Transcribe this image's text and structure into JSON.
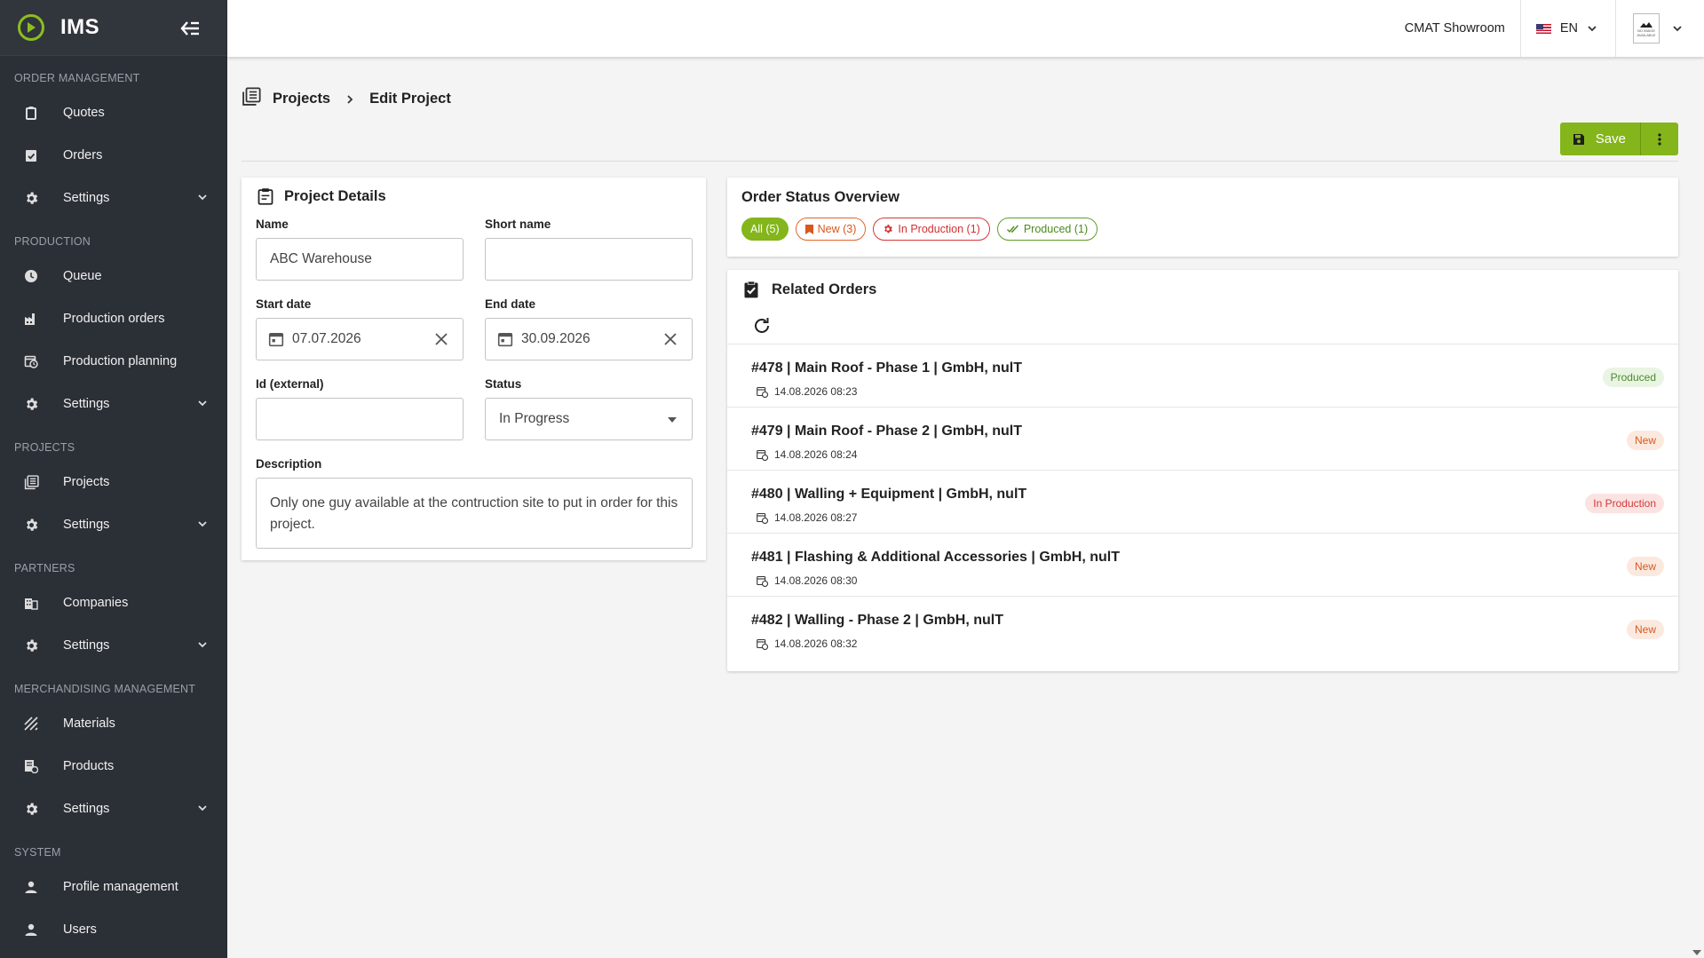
{
  "app": {
    "name": "IMS",
    "accent": "#84b51a"
  },
  "sidebar": {
    "sections": [
      {
        "title": "ORDER MANAGEMENT",
        "items": [
          {
            "label": "Quotes",
            "icon": "clipboard-icon"
          },
          {
            "label": "Orders",
            "icon": "clipboard-check-icon"
          },
          {
            "label": "Settings",
            "icon": "gear-icon",
            "expandable": true
          }
        ]
      },
      {
        "title": "PRODUCTION",
        "items": [
          {
            "label": "Queue",
            "icon": "clock-icon"
          },
          {
            "label": "Production orders",
            "icon": "factory-icon"
          },
          {
            "label": "Production planning",
            "icon": "calendar-clock-icon"
          },
          {
            "label": "Settings",
            "icon": "gear-icon",
            "expandable": true
          }
        ]
      },
      {
        "title": "PROJECTS",
        "items": [
          {
            "label": "Projects",
            "icon": "list-box-icon"
          },
          {
            "label": "Settings",
            "icon": "gear-icon",
            "expandable": true
          }
        ]
      },
      {
        "title": "PARTNERS",
        "items": [
          {
            "label": "Companies",
            "icon": "building-icon"
          },
          {
            "label": "Settings",
            "icon": "gear-icon",
            "expandable": true
          }
        ]
      },
      {
        "title": "MERCHANDISING MANAGEMENT",
        "items": [
          {
            "label": "Materials",
            "icon": "texture-icon"
          },
          {
            "label": "Products",
            "icon": "product-list-icon"
          },
          {
            "label": "Settings",
            "icon": "gear-icon",
            "expandable": true
          }
        ]
      },
      {
        "title": "SYSTEM",
        "items": [
          {
            "label": "Profile management",
            "icon": "person-icon"
          },
          {
            "label": "Users",
            "icon": "person-icon"
          }
        ]
      }
    ]
  },
  "topbar": {
    "org": "CMAT Showroom",
    "language": "EN",
    "avatar_text": [
      "NO IMAGE",
      "AVAILABLE"
    ]
  },
  "breadcrumb": {
    "parent": "Projects",
    "current": "Edit Project"
  },
  "actions": {
    "save_label": "Save"
  },
  "details": {
    "title": "Project Details",
    "name_label": "Name",
    "name_value": "ABC Warehouse",
    "short_label": "Short name",
    "short_value": "",
    "start_label": "Start date",
    "start_value": "07.07.2026",
    "end_label": "End date",
    "end_value": "30.09.2026",
    "external_label": "Id (external)",
    "external_value": "",
    "status_label": "Status",
    "status_value": "In Progress",
    "description_label": "Description",
    "description_value": "Only one guy available at the contruction site to put in order for this project."
  },
  "overview": {
    "title": "Order Status Overview",
    "chips": {
      "all": "All (5)",
      "new": "New (3)",
      "in_production": "In Production (1)",
      "produced": "Produced (1)"
    },
    "colors": {
      "new": "#d9561e",
      "in_production": "#d13033",
      "produced": "#4c8a1d"
    }
  },
  "related": {
    "title": "Related Orders",
    "orders": [
      {
        "title": "#478 | Main Roof - Phase 1 | GmbH, nulT",
        "date": "14.08.2026 08:23",
        "status": "Produced",
        "status_type": "produced"
      },
      {
        "title": "#479 | Main Roof - Phase 2 | GmbH, nulT",
        "date": "14.08.2026 08:24",
        "status": "New",
        "status_type": "new"
      },
      {
        "title": "#480 | Walling + Equipment | GmbH, nulT",
        "date": "14.08.2026 08:27",
        "status": "In Production",
        "status_type": "inprod"
      },
      {
        "title": "#481 | Flashing & Additional Accessories | GmbH, nulT",
        "date": "14.08.2026 08:30",
        "status": "New",
        "status_type": "new"
      },
      {
        "title": "#482 | Walling - Phase 2 | GmbH, nulT",
        "date": "14.08.2026 08:32",
        "status": "New",
        "status_type": "new"
      }
    ]
  }
}
